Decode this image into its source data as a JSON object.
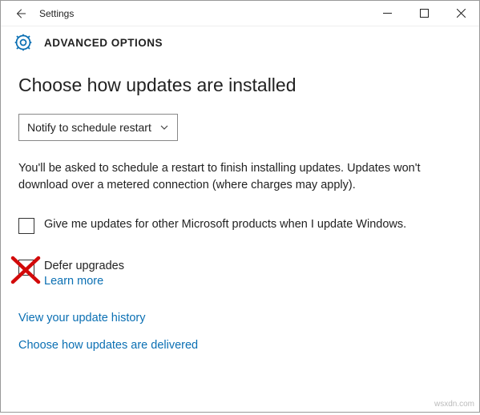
{
  "window": {
    "title": "Settings"
  },
  "header": {
    "page_title": "ADVANCED OPTIONS"
  },
  "main": {
    "section_heading": "Choose how updates are installed",
    "dropdown_value": "Notify to schedule restart",
    "body_text": "You'll be asked to schedule a restart to finish installing updates. Updates won't download over a metered connection (where charges may apply).",
    "checkbox_other_products": "Give me updates for other Microsoft products when I update Windows.",
    "defer_label": "Defer upgrades",
    "learn_more": "Learn more",
    "link_history": "View your update history",
    "link_delivered": "Choose how updates are delivered"
  },
  "watermark": "wsxdn.com"
}
